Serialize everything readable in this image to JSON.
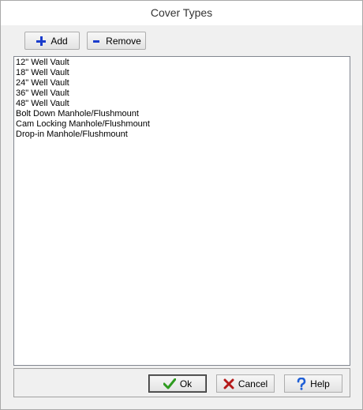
{
  "window": {
    "title": "Cover Types"
  },
  "toolbar": {
    "add_label": "Add",
    "remove_label": "Remove"
  },
  "list": {
    "items": [
      "12\" Well Vault",
      "18\" Well Vault",
      "24\" Well Vault",
      "36\" Well Vault",
      "48\" Well Vault",
      "Bolt Down Manhole/Flushmount",
      "Cam Locking Manhole/Flushmount",
      "Drop-in Manhole/Flushmount"
    ]
  },
  "buttons": {
    "ok_label": "Ok",
    "cancel_label": "Cancel",
    "help_label": "Help"
  },
  "icons": {
    "add": "plus-icon",
    "remove": "minus-icon",
    "ok": "checkmark-icon",
    "cancel": "x-icon",
    "help": "question-mark-icon"
  },
  "colors": {
    "icon_blue": "#1a3ccc",
    "ok_green": "#2e9b1f",
    "cancel_red": "#b51a1a",
    "help_blue": "#1f5fd6"
  }
}
